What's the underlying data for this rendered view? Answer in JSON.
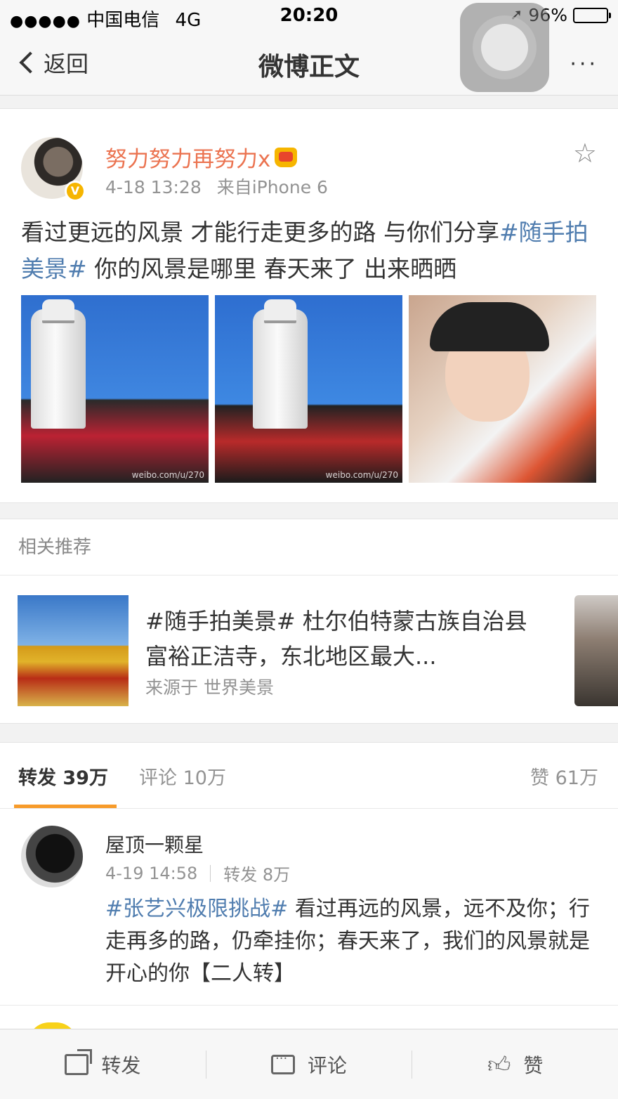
{
  "status": {
    "carrier": "中国电信",
    "network": "4G",
    "time": "20:20",
    "battery": "96%",
    "battery_level": 0.96
  },
  "nav": {
    "back_label": "返回",
    "title": "微博正文",
    "more": "···"
  },
  "post": {
    "author": "努力努力再努力x",
    "verified_badge": "V",
    "time": "4-18 13:28",
    "source": "来自iPhone 6",
    "text_before": "看过更远的风景 才能行走更多的路 与你们分享",
    "hashtag": "#随手拍美景#",
    "text_after": " 你的风景是哪里 春天来了 出来晒晒",
    "images": [
      {
        "watermark": "weibo.com/u/270"
      },
      {
        "watermark": "weibo.com/u/270"
      },
      {
        "watermark": ""
      }
    ]
  },
  "recommend": {
    "header": "相关推荐",
    "title": "#随手拍美景# 杜尔伯特蒙古族自治县富裕正洁寺，东北地区最大...",
    "source": "来源于 世界美景"
  },
  "tabs": {
    "repost": "转发 39万",
    "comment": "评论 10万",
    "like": "赞 61万"
  },
  "comment": {
    "name": "屋顶一颗星",
    "time": "4-19 14:58",
    "reposts": "转发 8万",
    "hashtag": "#张艺兴极限挑战#",
    "text": " 看过再远的风景，远不及你；行走再多的路，仍牵挂你；春天来了，我们的风景就是开心的你【二人转】"
  },
  "toolbar": {
    "repost": "转发",
    "comment": "评论",
    "like": "赞"
  }
}
